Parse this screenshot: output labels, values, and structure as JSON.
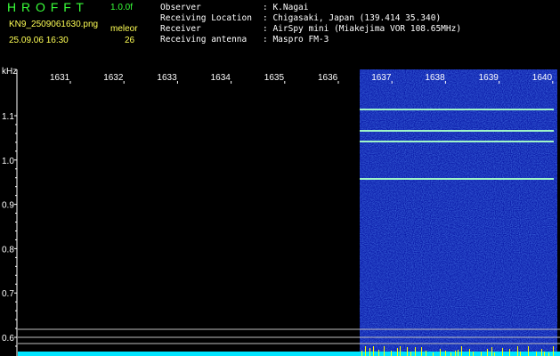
{
  "header": {
    "app_name": "H R O F F T",
    "version": "1.0.0f",
    "filename": "KN9_2509061630.png",
    "mode_label": "meleor",
    "datetime": "25.09.06 16:30",
    "count": "26",
    "observer_label": "Observer",
    "observer_value": ": K.Nagai",
    "location_label": "Receiving Location",
    "location_value": ": Chigasaki, Japan (139.414 35.340)",
    "receiver_label": "Receiver",
    "receiver_value": ": AirSpy mini (Miakejima VOR 108.65MHz)",
    "antenna_label": "Receiving antenna",
    "antenna_value": ": Maspro FM-3"
  },
  "plot": {
    "y_unit": "kHz",
    "x_ticks": [
      "1631",
      "1632",
      "1633",
      "1634",
      "1635",
      "1636",
      "1637",
      "1638",
      "1639",
      "1640"
    ],
    "y_ticks": [
      "1.1",
      "1.0",
      "0.9",
      "0.8",
      "0.7",
      "0.6"
    ],
    "colors": {
      "background": "#000000",
      "noise_bg": "#0a1aa8",
      "signal": "#7fffd4",
      "bottom_bar": "#00e5ff",
      "marker": "#ffff00"
    }
  }
}
